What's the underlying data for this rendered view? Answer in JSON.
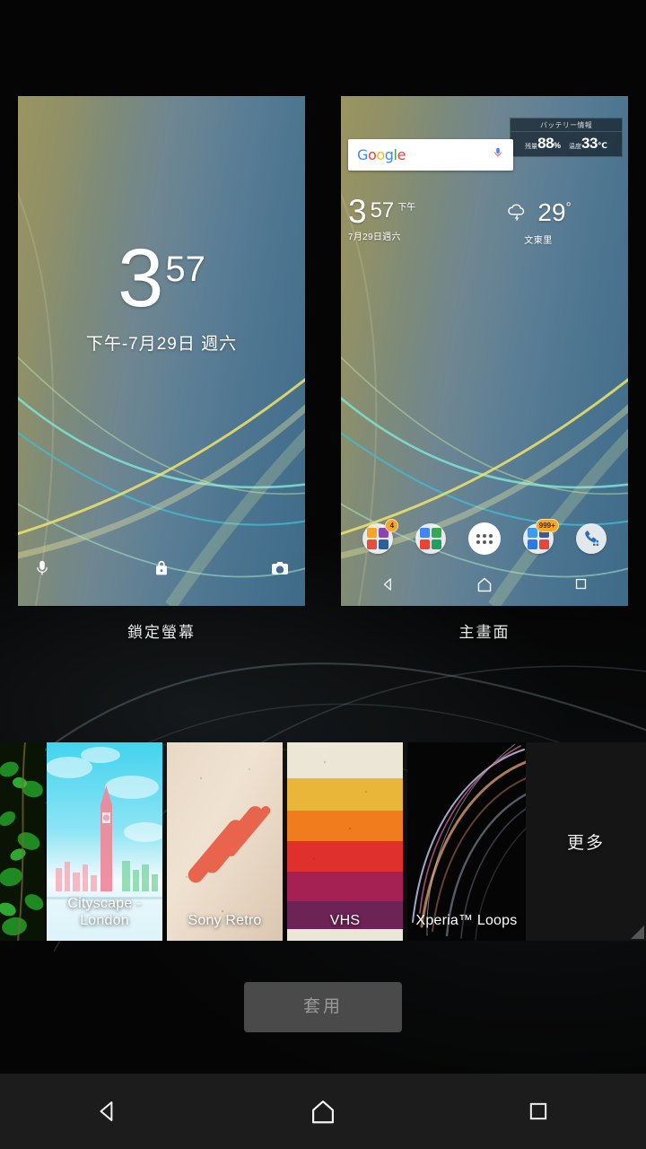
{
  "screen": {
    "title": "Xperia Theme / Wallpaper picker",
    "background_color": "#050505"
  },
  "previews": [
    {
      "key": "lock",
      "caption": "鎖定螢幕",
      "clock": {
        "hour": "3",
        "minute": "57",
        "date": "下午-7月29日 週六"
      },
      "bottom_icons": [
        {
          "name": "mic-icon",
          "glyph": "mic"
        },
        {
          "name": "lock-icon",
          "glyph": "lock"
        },
        {
          "name": "camera-icon",
          "glyph": "camera"
        }
      ]
    },
    {
      "key": "home",
      "caption": "主畫面",
      "battery_widget": {
        "title": "バッテリー情報",
        "remain_label": "残量",
        "remain_value": "88",
        "remain_unit": "%",
        "temp_label": "温度",
        "temp_value": "33",
        "temp_unit": "℃"
      },
      "search": {
        "logo": "Google",
        "letters": [
          "G",
          "o",
          "o",
          "g",
          "l",
          "e"
        ],
        "mic": "mic-icon"
      },
      "clock": {
        "hour": "3",
        "minute": "57",
        "ampm": "下午",
        "date": "7月29日週六"
      },
      "weather": {
        "icon": "rain-cloud-icon",
        "temp": "29",
        "degree": "°",
        "city": "文東里"
      },
      "dock": [
        {
          "name": "folder-1",
          "badge": "4",
          "colors": [
            "#f5a623",
            "#8e44ad",
            "#e74c3c",
            "#2c5f9e"
          ]
        },
        {
          "name": "folder-2",
          "badge": "",
          "colors": [
            "#4285F4",
            "#34A853",
            "#EA4335",
            "#1aa260"
          ]
        },
        {
          "name": "app-drawer",
          "badge": "",
          "colors": []
        },
        {
          "name": "folder-3",
          "badge": "999+",
          "colors": [
            "#3d9be9",
            "#3b5998",
            "#2c7be5",
            "#e8453c"
          ]
        },
        {
          "name": "phone-dialer",
          "badge": "",
          "colors": [
            "#2a6ebb"
          ]
        }
      ],
      "nav": [
        "back-icon",
        "home-icon",
        "recents-icon"
      ]
    }
  ],
  "thumbnails": [
    {
      "name": "leaves",
      "label": "",
      "type": "photo-leaves"
    },
    {
      "name": "cityscape",
      "label": "Cityscape - London",
      "type": "cityscape"
    },
    {
      "name": "sony-retro",
      "label": "Sony Retro",
      "type": "retro"
    },
    {
      "name": "vhs",
      "label": "VHS",
      "type": "vhs",
      "bands": [
        "#ece6d6",
        "#e9b63a",
        "#f07c1e",
        "#e0302c",
        "#a52154",
        "#6e2357",
        "#ece6d6"
      ]
    },
    {
      "name": "xperia-loops",
      "label": "Xperia™ Loops",
      "type": "loops"
    }
  ],
  "more_button": {
    "label": "更多"
  },
  "apply_button": {
    "label": "套用"
  },
  "system_nav": [
    {
      "name": "back-icon"
    },
    {
      "name": "home-icon"
    },
    {
      "name": "recents-icon"
    }
  ]
}
